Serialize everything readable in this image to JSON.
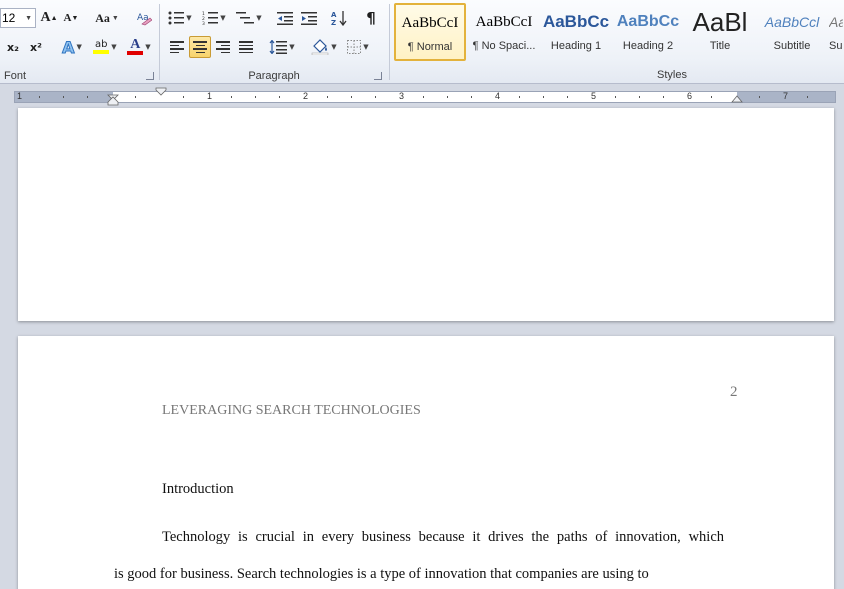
{
  "ribbon": {
    "font_group": {
      "label": "Font",
      "font_size": "12",
      "grow_font": "A",
      "shrink_font": "A",
      "change_case": "Aa",
      "subscript": "x₂",
      "superscript": "x²",
      "text_effects": "A",
      "highlight": "ab",
      "font_color": "A"
    },
    "paragraph_group": {
      "label": "Paragraph",
      "pilcrow": "¶"
    },
    "styles_group": {
      "label": "Styles",
      "styles": [
        {
          "sample": "AaBbCcI",
          "name": "¶ Normal",
          "selected": true
        },
        {
          "sample": "AaBbCcI",
          "name": "¶ No Spaci..."
        },
        {
          "sample": "AaBbCc",
          "name": "Heading 1"
        },
        {
          "sample": "AaBbCc",
          "name": "Heading 2"
        },
        {
          "sample": "AaBl",
          "name": "Title"
        },
        {
          "sample": "AaBbCcl",
          "name": "Subtitle"
        },
        {
          "sample": "Aa",
          "name": "Su"
        }
      ]
    }
  },
  "ruler": {
    "numbers": [
      "1",
      "1",
      "2",
      "3",
      "4",
      "5",
      "6",
      "7"
    ]
  },
  "document": {
    "page_number": "2",
    "running_head": "LEVERAGING SEARCH TECHNOLOGIES",
    "heading": "Introduction",
    "para1_line1": "Technology is crucial in every business because it drives the paths of innovation, which",
    "para1_line2": "is good for business.  Search technologies is a type of innovation that companies  are using to"
  },
  "colors": {
    "accent": "#e3b23c",
    "heading1": "#2b579a",
    "heading2": "#4f81bd",
    "subtitle": "#4f81bd",
    "font_color_bar": "#e00000",
    "highlight_bar": "#ffff00"
  }
}
